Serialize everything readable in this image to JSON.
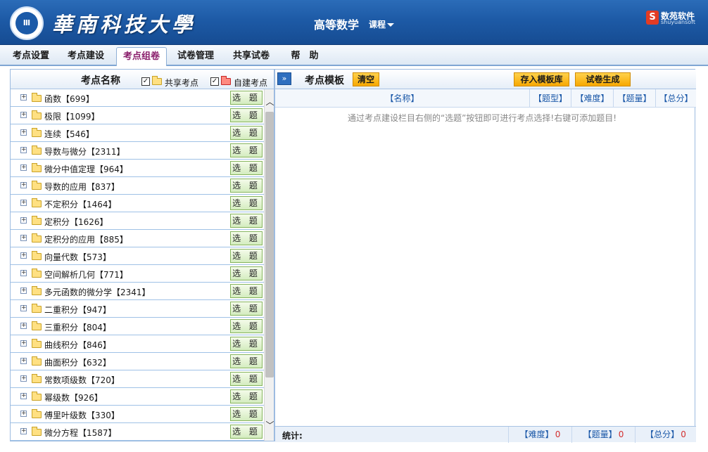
{
  "header": {
    "logo_text": "UNIVERSITY",
    "school_name": "華南科技大學",
    "subject": "高等数学",
    "course_menu_label": "课程",
    "brand": {
      "name": "数苑软件",
      "sub": "shuyuansoft"
    }
  },
  "nav": {
    "tabs": [
      {
        "label": "考点设置"
      },
      {
        "label": "考点建设"
      },
      {
        "label": "考点组卷",
        "active": true
      },
      {
        "label": "试卷管理"
      },
      {
        "label": "共享试卷"
      },
      {
        "label": "帮　助"
      }
    ]
  },
  "left_panel": {
    "title": "考点名称",
    "legend_shared": "共享考点",
    "legend_custom": "自建考点",
    "pick_label": "选 题",
    "items": [
      {
        "label": "函数【699】"
      },
      {
        "label": "极限【1099】"
      },
      {
        "label": "连续【546】"
      },
      {
        "label": "导数与微分【2311】"
      },
      {
        "label": "微分中值定理【964】"
      },
      {
        "label": "导数的应用【837】"
      },
      {
        "label": "不定积分【1464】"
      },
      {
        "label": "定积分【1626】"
      },
      {
        "label": "定积分的应用【885】"
      },
      {
        "label": "向量代数【573】"
      },
      {
        "label": "空间解析几何【771】"
      },
      {
        "label": "多元函数的微分学【2341】"
      },
      {
        "label": "二重积分【947】"
      },
      {
        "label": "三重积分【804】"
      },
      {
        "label": "曲线积分【846】"
      },
      {
        "label": "曲面积分【632】"
      },
      {
        "label": "常数项级数【720】"
      },
      {
        "label": "幂级数【926】"
      },
      {
        "label": "傅里叶级数【330】"
      },
      {
        "label": "微分方程【1587】"
      }
    ]
  },
  "right_panel": {
    "title": "考点模板",
    "clear_label": "清空",
    "save_template_label": "存入模板库",
    "generate_label": "试卷生成",
    "columns": [
      "【名称】",
      "【题型】",
      "【难度】",
      "【题量】",
      "【总分】"
    ],
    "hint": "通过考点建设栏目右侧的“选题”按钮即可进行考点选择!右键可添加题目!",
    "stats": {
      "label": "统计:",
      "difficulty_label": "【难度】",
      "difficulty_value": "0",
      "count_label": "【题量】",
      "count_value": "0",
      "score_label": "【总分】",
      "score_value": "0"
    }
  },
  "colors": {
    "accent": "#1d5aa6",
    "active_tab": "#8a1e6c",
    "orange_button": "#f7a800",
    "pick_button": "#d4ecbf"
  }
}
